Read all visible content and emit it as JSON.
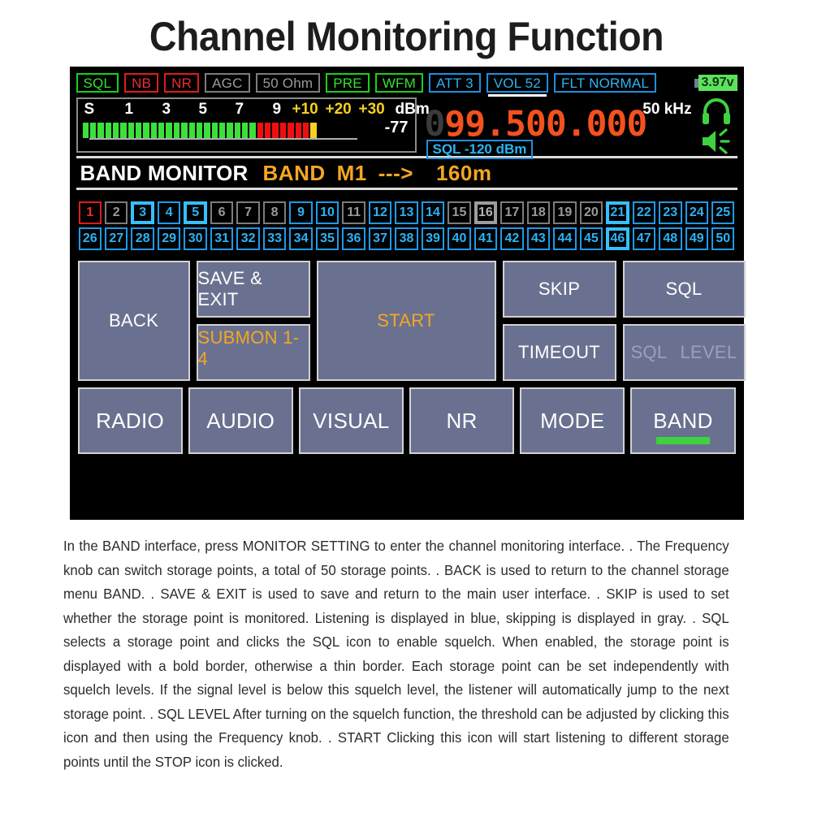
{
  "page": {
    "title": "Channel Monitoring Function"
  },
  "statusbar": {
    "chips": [
      {
        "label": "SQL",
        "style": "green"
      },
      {
        "label": "NB",
        "style": "red"
      },
      {
        "label": "NR",
        "style": "red"
      },
      {
        "label": "AGC",
        "style": "gray"
      },
      {
        "label": "50 Ohm",
        "style": "gray"
      },
      {
        "label": "PRE",
        "style": "green"
      },
      {
        "label": "WFM",
        "style": "green"
      },
      {
        "label": "ATT 3",
        "style": "blue"
      },
      {
        "label": "VOL 52",
        "style": "blue",
        "underline": true
      },
      {
        "label": "FLT NORMAL",
        "style": "blue"
      }
    ],
    "battery": {
      "value": "3.97v",
      "color": "#5ce35c",
      "icon": "battery-icon"
    }
  },
  "meter": {
    "s_label": "S",
    "ticks": [
      "1",
      "3",
      "5",
      "7",
      "9"
    ],
    "plus_ticks": [
      "+10",
      "+20",
      "+30"
    ],
    "unit": "dBm",
    "reading": "-77",
    "green_segments": 23,
    "red_segments": 7,
    "yellow_segments": 1,
    "total_segments": 34
  },
  "frequency": {
    "leading_digit": "0",
    "value": "99.500.000",
    "step": "50 kHz",
    "sql_level": "SQL -120 dBm",
    "color": "#f4511e"
  },
  "icons": {
    "headphone": "headphone-icon",
    "speaker": "speaker-icon"
  },
  "bandmonitor": {
    "title": "BAND MONITOR",
    "band_label": "BAND",
    "memory": "M1",
    "arrow": "--->",
    "band_value": "160m"
  },
  "channels": {
    "count": 50,
    "items": [
      {
        "n": "1",
        "state": "red"
      },
      {
        "n": "2",
        "state": "gray"
      },
      {
        "n": "3",
        "state": "blue-bold"
      },
      {
        "n": "4",
        "state": "blue"
      },
      {
        "n": "5",
        "state": "blue-bold"
      },
      {
        "n": "6",
        "state": "gray"
      },
      {
        "n": "7",
        "state": "gray"
      },
      {
        "n": "8",
        "state": "gray"
      },
      {
        "n": "9",
        "state": "blue"
      },
      {
        "n": "10",
        "state": "blue"
      },
      {
        "n": "11",
        "state": "gray"
      },
      {
        "n": "12",
        "state": "blue"
      },
      {
        "n": "13",
        "state": "blue"
      },
      {
        "n": "14",
        "state": "blue"
      },
      {
        "n": "15",
        "state": "gray"
      },
      {
        "n": "16",
        "state": "gray-bold"
      },
      {
        "n": "17",
        "state": "gray"
      },
      {
        "n": "18",
        "state": "gray"
      },
      {
        "n": "19",
        "state": "gray"
      },
      {
        "n": "20",
        "state": "gray"
      },
      {
        "n": "21",
        "state": "blue-bold"
      },
      {
        "n": "22",
        "state": "blue"
      },
      {
        "n": "23",
        "state": "blue"
      },
      {
        "n": "24",
        "state": "blue"
      },
      {
        "n": "25",
        "state": "blue"
      },
      {
        "n": "26",
        "state": "blue"
      },
      {
        "n": "27",
        "state": "blue"
      },
      {
        "n": "28",
        "state": "blue"
      },
      {
        "n": "29",
        "state": "blue"
      },
      {
        "n": "30",
        "state": "blue"
      },
      {
        "n": "31",
        "state": "blue"
      },
      {
        "n": "32",
        "state": "blue"
      },
      {
        "n": "33",
        "state": "blue"
      },
      {
        "n": "34",
        "state": "blue"
      },
      {
        "n": "35",
        "state": "blue"
      },
      {
        "n": "36",
        "state": "blue"
      },
      {
        "n": "37",
        "state": "blue"
      },
      {
        "n": "38",
        "state": "blue"
      },
      {
        "n": "39",
        "state": "blue"
      },
      {
        "n": "40",
        "state": "blue"
      },
      {
        "n": "41",
        "state": "blue"
      },
      {
        "n": "42",
        "state": "blue"
      },
      {
        "n": "43",
        "state": "blue"
      },
      {
        "n": "44",
        "state": "blue"
      },
      {
        "n": "45",
        "state": "blue"
      },
      {
        "n": "46",
        "state": "blue-bold"
      },
      {
        "n": "47",
        "state": "blue"
      },
      {
        "n": "48",
        "state": "blue"
      },
      {
        "n": "49",
        "state": "blue"
      },
      {
        "n": "50",
        "state": "blue"
      }
    ]
  },
  "buttons": {
    "back": "BACK",
    "save_exit": "SAVE & EXIT",
    "submon": "SUBMON  1-4",
    "start": "START",
    "skip": "SKIP",
    "timeout": "TIMEOUT",
    "sql": "SQL",
    "sql_level_a": "SQL",
    "sql_level_b": "LEVEL"
  },
  "menu": {
    "items": [
      {
        "label": "RADIO",
        "active": false
      },
      {
        "label": "AUDIO",
        "active": false
      },
      {
        "label": "VISUAL",
        "active": false
      },
      {
        "label": "NR",
        "active": false
      },
      {
        "label": "MODE",
        "active": false
      },
      {
        "label": "BAND",
        "active": true
      }
    ],
    "active_color": "#3fd13f"
  },
  "description": "In the BAND interface, press MONITOR SETTING to enter the channel monitoring interface. . The Frequency knob can switch storage points, a total of 50 storage points. . BACK is used to return to the channel storage menu BAND. . SAVE & EXIT is used to save and return to the main user interface. . SKIP is used to set whether the storage point is monitored. Listening is displayed in blue, skipping is displayed in gray. . SQL selects a storage point and clicks the SQL icon to enable squelch. When enabled, the storage point is displayed with a bold border, otherwise a thin border. Each storage point can be set independently with squelch levels. If the signal level is below this squelch level, the listener will automatically jump to the next storage point. . SQL LEVEL After turning on the squelch function, the threshold can be adjusted by clicking this icon and then using the Frequency knob. . START Clicking this icon will start listening to different storage points until the STOP icon is clicked."
}
